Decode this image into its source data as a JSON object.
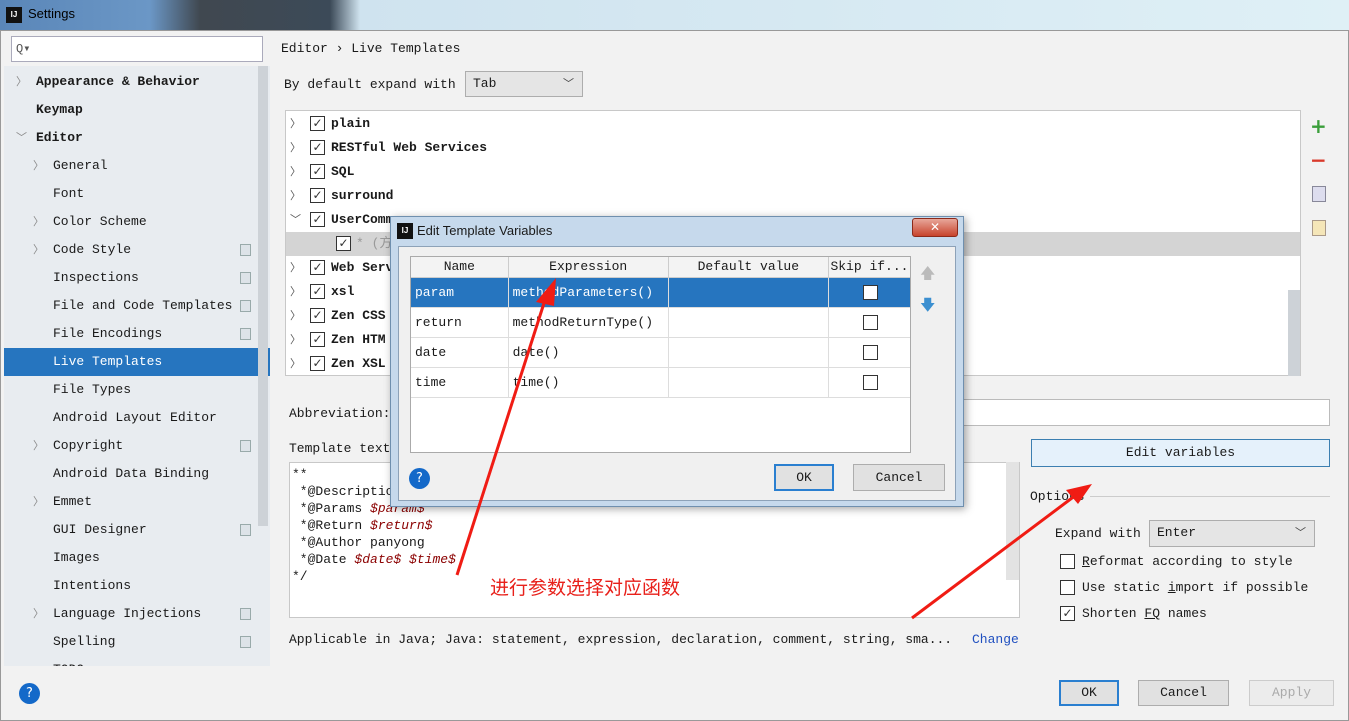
{
  "window": {
    "title": "Settings"
  },
  "search": {
    "placeholder": "Q▾",
    "value": ""
  },
  "sidebar": {
    "items": [
      {
        "label": "Appearance & Behavior",
        "level": 0,
        "expandable": true
      },
      {
        "label": "Keymap",
        "level": 0
      },
      {
        "label": "Editor",
        "level": 0,
        "expanded": true
      },
      {
        "label": "General",
        "level": 1,
        "expandable": true
      },
      {
        "label": "Font",
        "level": 1
      },
      {
        "label": "Color Scheme",
        "level": 1,
        "expandable": true
      },
      {
        "label": "Code Style",
        "level": 1,
        "expandable": true,
        "project": true
      },
      {
        "label": "Inspections",
        "level": 1,
        "project": true
      },
      {
        "label": "File and Code Templates",
        "level": 1,
        "project": true
      },
      {
        "label": "File Encodings",
        "level": 1,
        "project": true
      },
      {
        "label": "Live Templates",
        "level": 1,
        "selected": true
      },
      {
        "label": "File Types",
        "level": 1
      },
      {
        "label": "Android Layout Editor",
        "level": 1
      },
      {
        "label": "Copyright",
        "level": 1,
        "expandable": true,
        "project": true
      },
      {
        "label": "Android Data Binding",
        "level": 1
      },
      {
        "label": "Emmet",
        "level": 1,
        "expandable": true
      },
      {
        "label": "GUI Designer",
        "level": 1,
        "project": true
      },
      {
        "label": "Images",
        "level": 1
      },
      {
        "label": "Intentions",
        "level": 1
      },
      {
        "label": "Language Injections",
        "level": 1,
        "expandable": true,
        "project": true
      },
      {
        "label": "Spelling",
        "level": 1,
        "project": true
      },
      {
        "label": "TODO",
        "level": 1
      }
    ]
  },
  "main": {
    "breadcrumb": {
      "parent": "Editor",
      "sep": "›",
      "current": "Live Templates"
    },
    "expand_label": "By default expand with",
    "expand_value": "Tab",
    "groups": [
      {
        "label": "plain",
        "checked": true
      },
      {
        "label": "RESTful Web Services",
        "checked": true
      },
      {
        "label": "SQL",
        "checked": true
      },
      {
        "label": "surround",
        "checked": true
      },
      {
        "label": "UserComm",
        "checked": true,
        "expanded": true
      },
      {
        "label": "* (方",
        "checked": true,
        "child": true,
        "selected": true
      },
      {
        "label": "Web Serv",
        "checked": true
      },
      {
        "label": "xsl",
        "checked": true
      },
      {
        "label": "Zen CSS",
        "checked": true
      },
      {
        "label": "Zen HTM",
        "checked": true
      },
      {
        "label": "Zen XSL",
        "checked": true
      }
    ],
    "abbreviation_label": "Abbreviation:",
    "abbreviation_value": "",
    "template_text_label": "Template text:",
    "template_lines": [
      [
        {
          "t": "**"
        }
      ],
      [
        {
          "t": " *@Description"
        }
      ],
      [
        {
          "t": " *@Params "
        },
        {
          "t": "$param$",
          "v": true
        }
      ],
      [
        {
          "t": " *@Return "
        },
        {
          "t": "$return$",
          "v": true
        }
      ],
      [
        {
          "t": " *@Author panyong"
        }
      ],
      [
        {
          "t": " *@Date "
        },
        {
          "t": "$date$",
          "v": true
        },
        {
          "t": " "
        },
        {
          "t": "$time$",
          "v": true
        }
      ],
      [
        {
          "t": "*/"
        }
      ]
    ],
    "edit_variables": "Edit variables",
    "options_label": "Options",
    "expand_with_label": "Expand with",
    "expand_with_value": "Enter",
    "options": [
      {
        "pre": "",
        "u": "R",
        "post": "eformat according to style",
        "checked": false
      },
      {
        "pre": "Use static ",
        "u": "i",
        "post": "mport if possible",
        "checked": false
      },
      {
        "pre": "Shorten ",
        "u": "FQ",
        "post": " names",
        "checked": true
      }
    ],
    "applicable": "Applicable in Java; Java: statement, expression, declaration, comment, string, sma...",
    "change_link": "Change"
  },
  "dialog": {
    "title": "Edit Template Variables",
    "columns": [
      "Name",
      "Expression",
      "Default value",
      "Skip if..."
    ],
    "rows": [
      {
        "name": "param",
        "expression": "methodParameters()",
        "default": "",
        "skip": false
      },
      {
        "name": "return",
        "expression": "methodReturnType()",
        "default": "",
        "skip": false
      },
      {
        "name": "date",
        "expression": "date()",
        "default": "",
        "skip": false
      },
      {
        "name": "time",
        "expression": "time()",
        "default": "",
        "skip": false
      }
    ],
    "ok": "OK",
    "cancel": "Cancel"
  },
  "annotation": {
    "text": "进行参数选择对应函数",
    "color": "#e8201a"
  },
  "footer": {
    "ok": "OK",
    "cancel": "Cancel",
    "apply": "Apply"
  },
  "colors": {
    "accent": "#2675bf",
    "add": "#3a9e3a",
    "remove": "#d9392b"
  }
}
